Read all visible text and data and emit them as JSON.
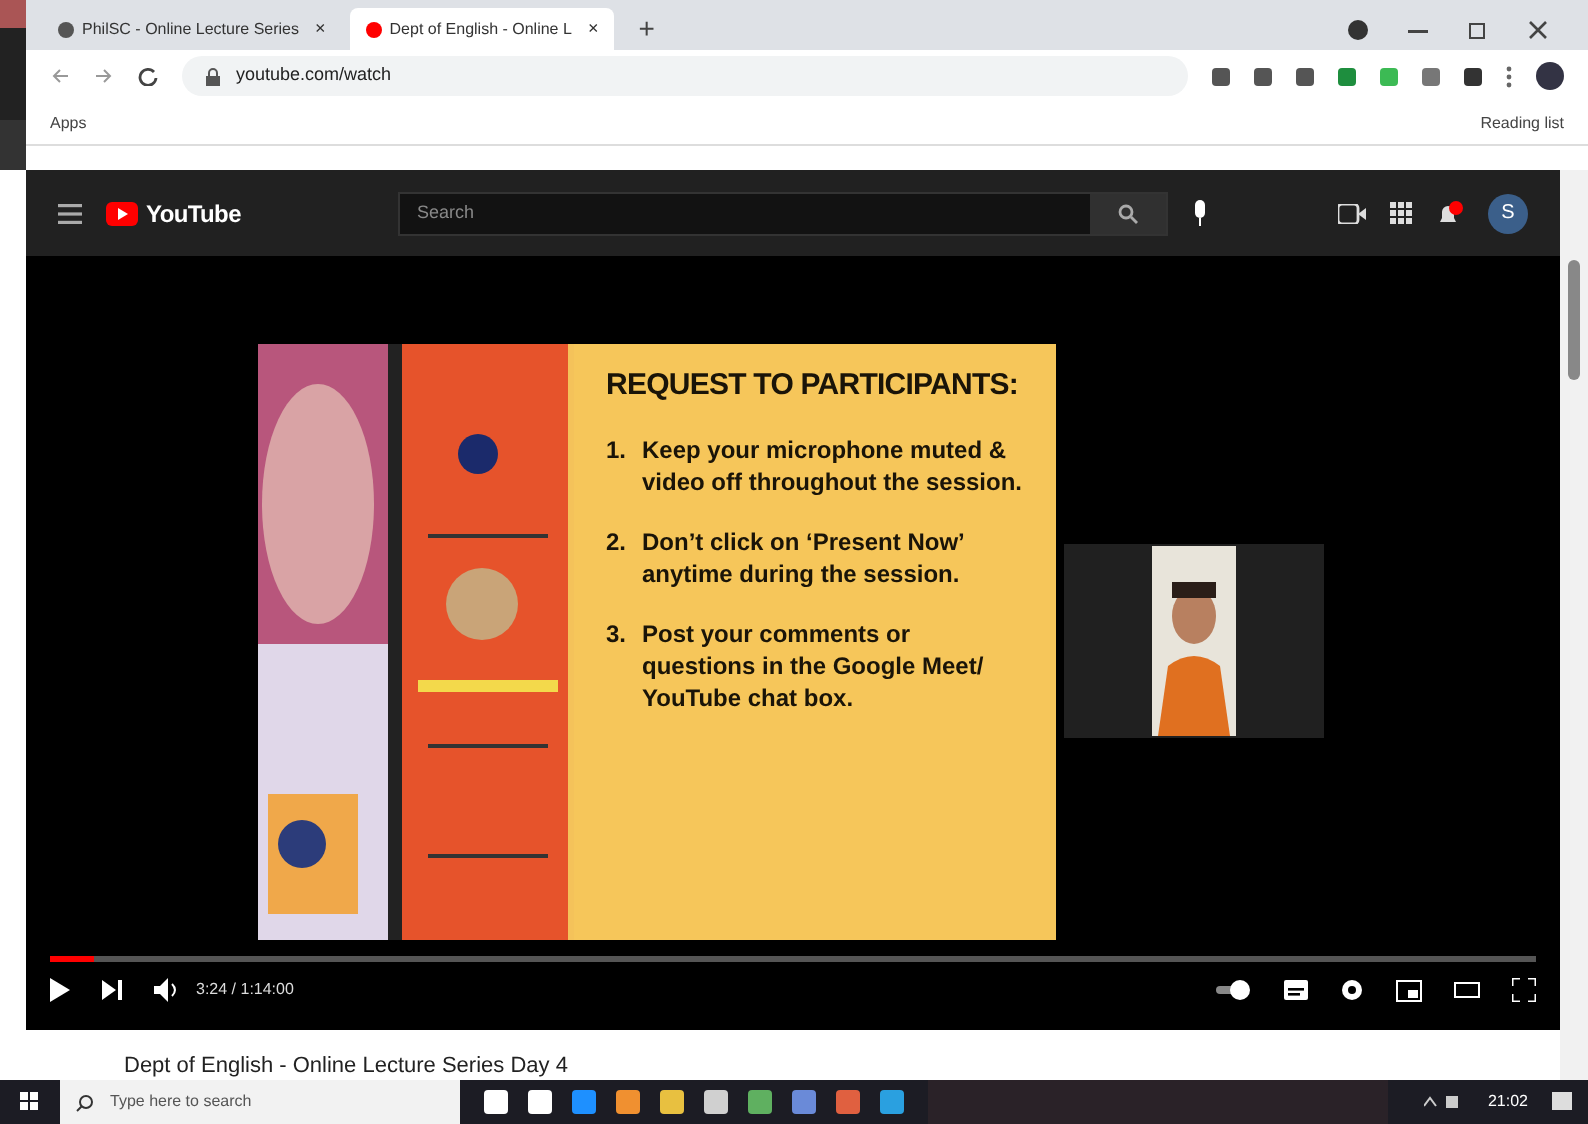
{
  "browser": {
    "tabs": [
      {
        "title": "PhilSC - Online Lecture Series",
        "close": "×",
        "selected": false
      },
      {
        "title": "Dept of English - Online L",
        "close": "×",
        "selected": true
      }
    ],
    "new_tab": "+",
    "url": "youtube.com/watch",
    "bookmarks": [
      "Apps"
    ],
    "reading_list": "Reading list"
  },
  "youtube": {
    "logo": "YouTube",
    "search": {
      "placeholder": "Search"
    },
    "avatar": "S"
  },
  "player": {
    "slide": {
      "heading": "REQUEST TO PARTICIPANTS:",
      "points": [
        {
          "number": "1.",
          "text": "Keep your microphone muted & video off throughout the session."
        },
        {
          "number": "2.",
          "text": "Don’t click on ‘Present Now’ anytime during the session."
        },
        {
          "number": "3.",
          "text": "Post your comments or questions in the Google Meet/ YouTube chat box."
        }
      ]
    },
    "progress": {
      "level": 0.03
    },
    "time": "3:24 / 1:14:00"
  },
  "video_title": "Dept of English - Online Lecture Series Day 4",
  "taskbar": {
    "search": {
      "placeholder": "Type here to search"
    },
    "clock": "21:02"
  }
}
